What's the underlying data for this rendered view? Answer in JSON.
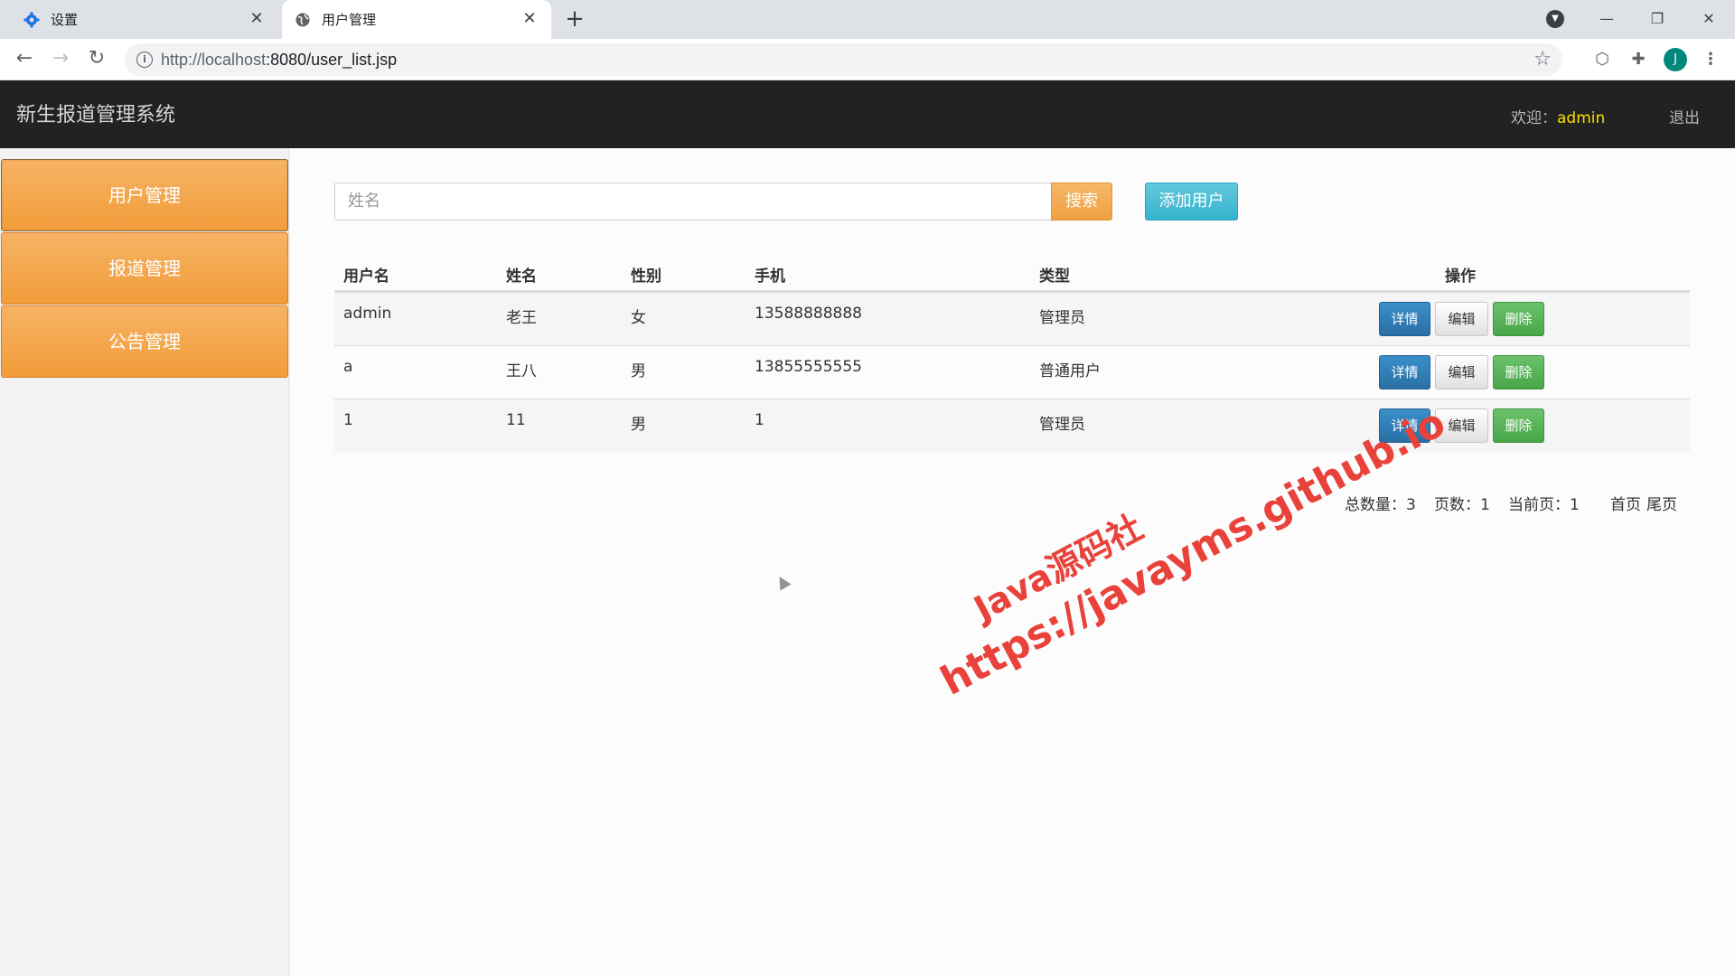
{
  "browser": {
    "tabs": [
      {
        "title": "设置",
        "icon": "gear-icon"
      },
      {
        "title": "用户管理",
        "icon": "globe-icon"
      }
    ],
    "url_host": "http://localhost",
    "url_rest": ":8080/user_list.jsp",
    "avatar_letter": "J"
  },
  "header": {
    "brand": "新生报道管理系统",
    "welcome_label": "欢迎：",
    "username": "admin",
    "logout": "退出"
  },
  "sidebar": {
    "items": [
      {
        "label": "用户管理"
      },
      {
        "label": "报道管理"
      },
      {
        "label": "公告管理"
      }
    ]
  },
  "search": {
    "placeholder": "姓名",
    "search_label": "搜索",
    "add_label": "添加用户"
  },
  "table": {
    "headers": [
      "用户名",
      "姓名",
      "性别",
      "手机",
      "类型",
      "操作"
    ],
    "rows": [
      {
        "username": "admin",
        "name": "老王",
        "gender": "女",
        "phone": "13588888888",
        "type": "管理员"
      },
      {
        "username": "a",
        "name": "王八",
        "gender": "男",
        "phone": "13855555555",
        "type": "普通用户"
      },
      {
        "username": "1",
        "name": "11",
        "gender": "男",
        "phone": "1",
        "type": "管理员"
      }
    ],
    "actions": {
      "detail": "详情",
      "edit": "编辑",
      "delete": "删除"
    }
  },
  "pager": {
    "total_label": "总数量：3",
    "pages_label": "页数：1",
    "current_label": "当前页：1",
    "first": "首页",
    "last": "尾页"
  },
  "watermark": {
    "line1": "Java源码社",
    "line2": "https://javayms.github.io"
  },
  "colors": {
    "header_bg": "#222222",
    "sidebar_orange": "#f29c3a",
    "username_yellow": "#f7e000",
    "detail_blue": "#2a6fa6",
    "delete_green": "#48a648",
    "add_cyan": "#36b2cc"
  }
}
